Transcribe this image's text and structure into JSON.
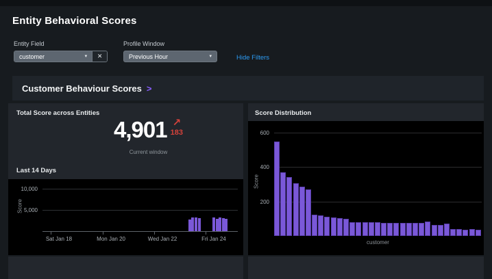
{
  "page": {
    "title": "Entity Behavioral Scores"
  },
  "filters": {
    "entity_field_label": "Entity Field",
    "entity_field_value": "customer",
    "clear_icon": "✕",
    "caret_icon": "▾",
    "profile_window_label": "Profile Window",
    "profile_window_value": "Previous Hour",
    "hide_filters_label": "Hide Filters"
  },
  "section": {
    "title": "Customer Behaviour Scores",
    "chevron_icon": ">"
  },
  "total_score_panel": {
    "title": "Total Score across Entities",
    "value": "4,901",
    "trend_arrow_icon": "↗",
    "delta": "183",
    "caption": "Current window",
    "sparkline_title": "Last 14 Days"
  },
  "distribution_panel": {
    "title": "Score Distribution"
  },
  "colors": {
    "accent_purple": "#7a58d8",
    "trend_red": "#d4423b",
    "link_blue": "#2d9cf4",
    "panel_bg": "#22262c",
    "chart_bg": "#000000"
  },
  "chart_data": [
    {
      "id": "total-score-sparkline",
      "type": "bar",
      "title": "Last 14 Days",
      "ylabel": "Score",
      "xlabel": "",
      "ylim": [
        0,
        11600
      ],
      "grid": true,
      "yticks": [
        {
          "value": 5000,
          "label": "5,000"
        },
        {
          "value": 10000,
          "label": "10,000"
        }
      ],
      "xticks": [
        {
          "pos": 0.042,
          "label": "Sat Jan 18"
        },
        {
          "pos": 0.309,
          "label": "Mon Jan 20"
        },
        {
          "pos": 0.572,
          "label": "Wed Jan 22"
        },
        {
          "pos": 0.835,
          "label": "Fri Jan 24"
        }
      ],
      "bars": [
        {
          "pos": 0.747,
          "value": 2700
        },
        {
          "pos": 0.763,
          "value": 3200
        },
        {
          "pos": 0.779,
          "value": 3150
        },
        {
          "pos": 0.795,
          "value": 3000
        },
        {
          "pos": 0.87,
          "value": 3200
        },
        {
          "pos": 0.886,
          "value": 2900
        },
        {
          "pos": 0.902,
          "value": 3200
        },
        {
          "pos": 0.918,
          "value": 3050
        },
        {
          "pos": 0.933,
          "value": 2900
        }
      ]
    },
    {
      "id": "score-distribution",
      "type": "bar",
      "title": "Score Distribution",
      "ylabel": "Score",
      "xlabel": "customer",
      "ylim": [
        0,
        632
      ],
      "grid": true,
      "yticks": [
        {
          "value": 200,
          "label": "200"
        },
        {
          "value": 400,
          "label": "400"
        },
        {
          "value": 600,
          "label": "600"
        }
      ],
      "values": [
        550,
        370,
        340,
        305,
        285,
        270,
        125,
        120,
        113,
        108,
        104,
        98,
        80,
        80,
        79,
        78,
        78,
        77,
        76,
        76,
        75,
        75,
        74,
        74,
        84,
        62,
        62,
        70,
        40,
        40,
        37,
        40,
        36
      ]
    }
  ]
}
